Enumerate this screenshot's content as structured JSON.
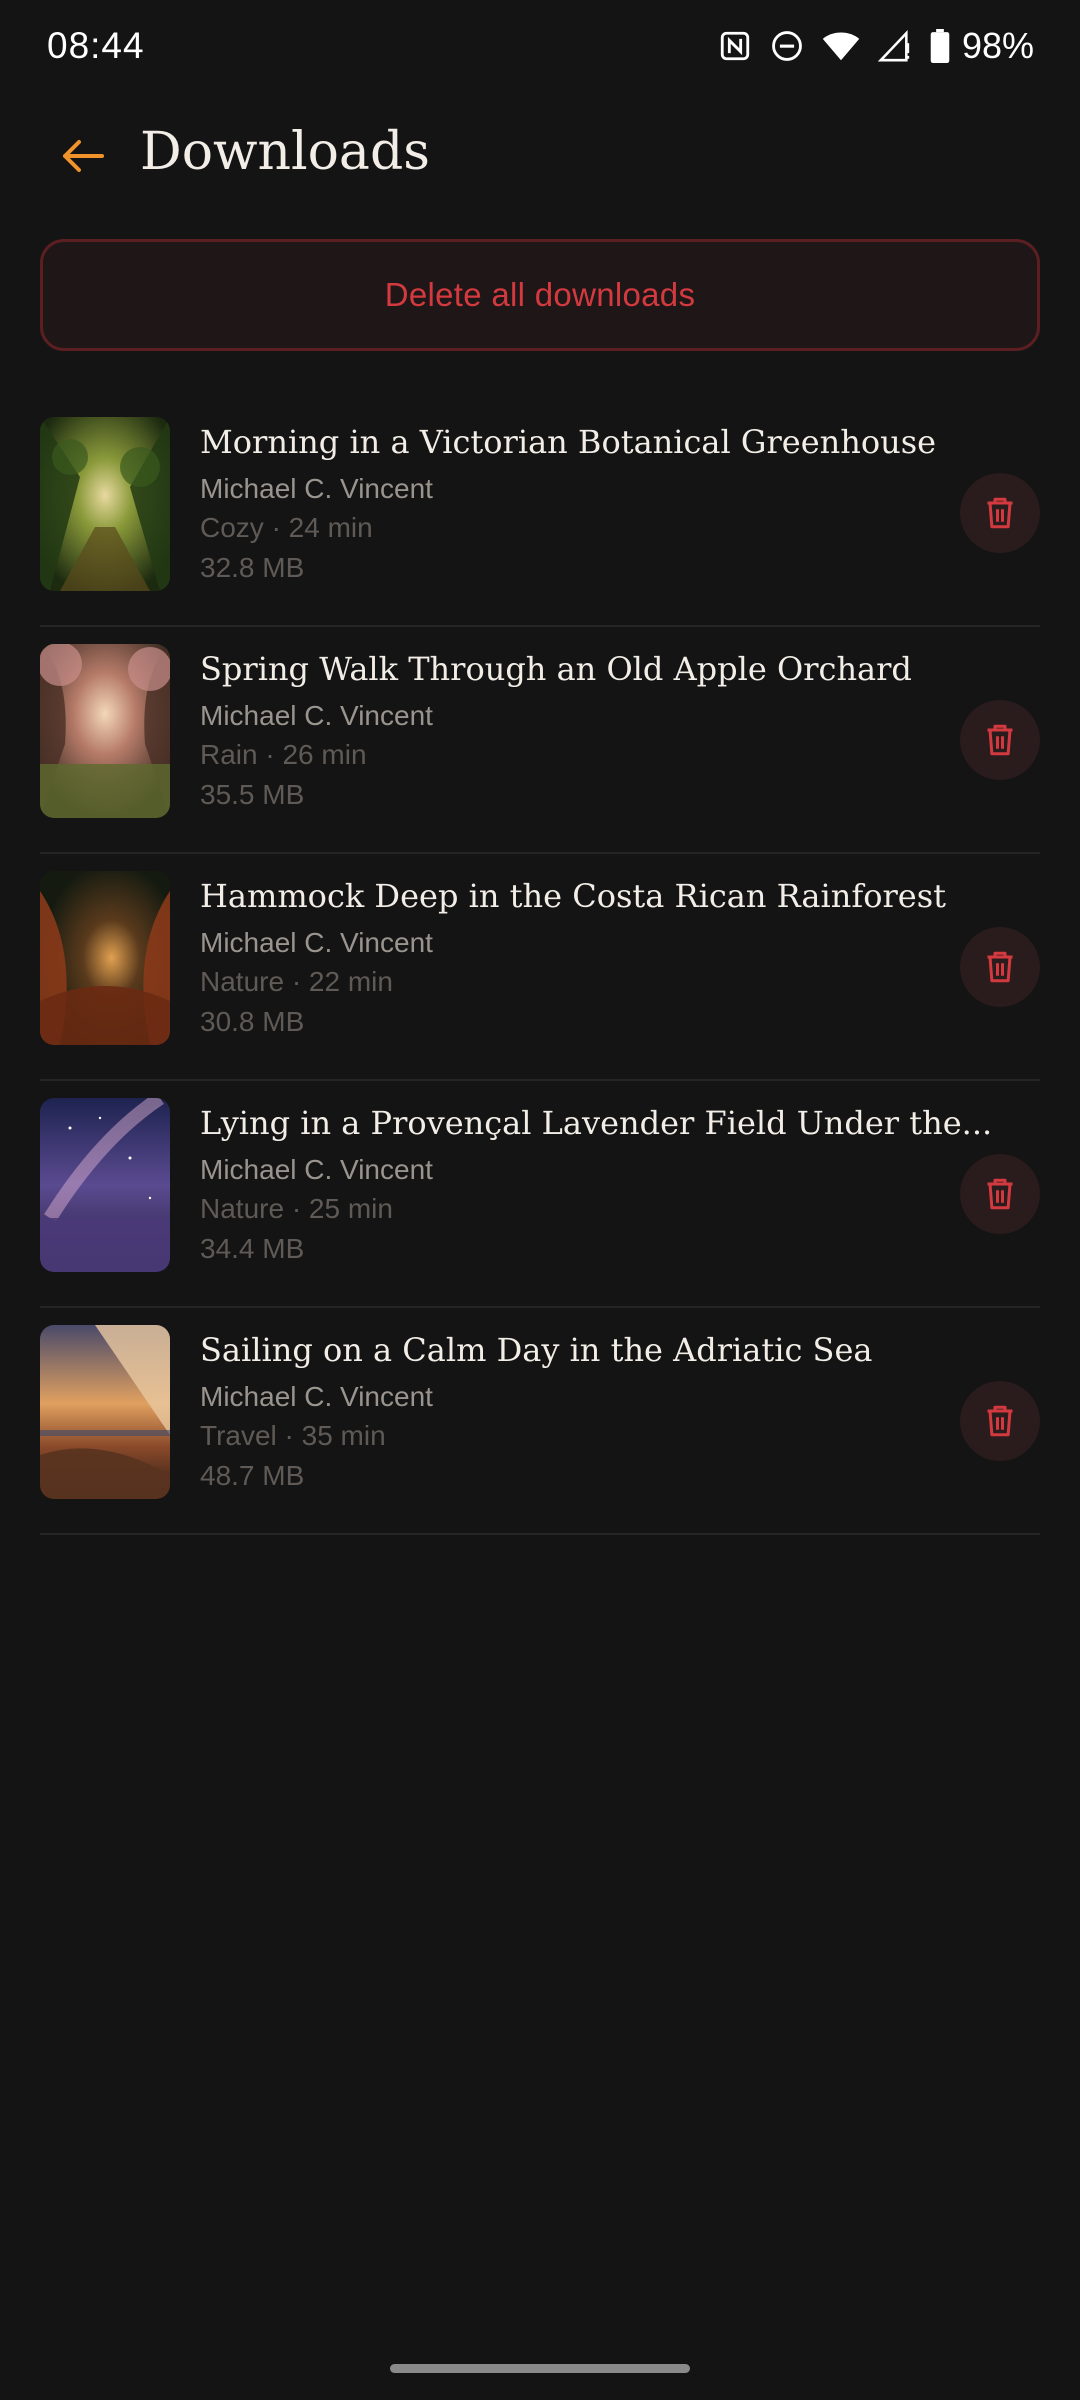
{
  "status_bar": {
    "time": "08:44",
    "battery": "98%"
  },
  "header": {
    "title": "Downloads"
  },
  "delete_all_label": "Delete all downloads",
  "colors": {
    "accent": "#f0932b",
    "danger": "#d23a3f",
    "background": "#141414"
  },
  "items": [
    {
      "title": "Morning in a Victorian Botanical Greenhouse",
      "author": "Michael C. Vincent",
      "meta": "Cozy · 24 min",
      "size": "32.8 MB"
    },
    {
      "title": "Spring Walk Through an Old Apple Orchard",
      "author": "Michael C. Vincent",
      "meta": "Rain · 26 min",
      "size": "35.5 MB"
    },
    {
      "title": "Hammock Deep in the Costa Rican Rainforest",
      "author": "Michael C. Vincent",
      "meta": "Nature · 22 min",
      "size": "30.8 MB"
    },
    {
      "title": "Lying in a Provençal Lavender Field Under the...",
      "author": "Michael C. Vincent",
      "meta": "Nature · 25 min",
      "size": "34.4 MB"
    },
    {
      "title": "Sailing on a Calm Day in the Adriatic Sea",
      "author": "Michael C. Vincent",
      "meta": "Travel · 35 min",
      "size": "48.7 MB"
    }
  ]
}
